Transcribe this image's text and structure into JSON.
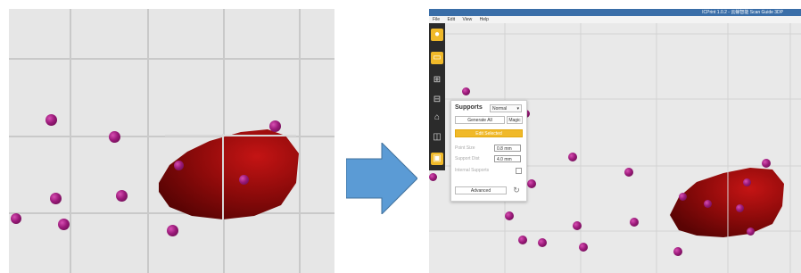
{
  "app": {
    "title": "ICPrint 1.0.2 - 云鲸智能 Scan Guide 3DP",
    "menu": [
      "File",
      "Edit",
      "View",
      "Help"
    ]
  },
  "toolbar": {
    "icons": [
      "logo-icon",
      "open-folder-icon",
      "model-view-icon",
      "layout-icon",
      "supports-icon",
      "split-icon",
      "save-icon"
    ]
  },
  "supports_panel": {
    "title": "Supports",
    "mode_select": "Normal",
    "generate_all_label": "Generate All",
    "magic_label": "Magic",
    "edit_selected_label": "Edit Selected",
    "point_size_label": "Point Size",
    "point_size_value": "0.8 mm",
    "support_dist_label": "Support Dist",
    "support_dist_value": "4.0 mm",
    "internal_supports_label": "Internal Supports",
    "advanced_label": "Advanced"
  },
  "colors": {
    "accent": "#f0b929",
    "model": "#8b0a0a",
    "support_point": "#9b1a7a",
    "arrow": "#5b9bd5"
  }
}
